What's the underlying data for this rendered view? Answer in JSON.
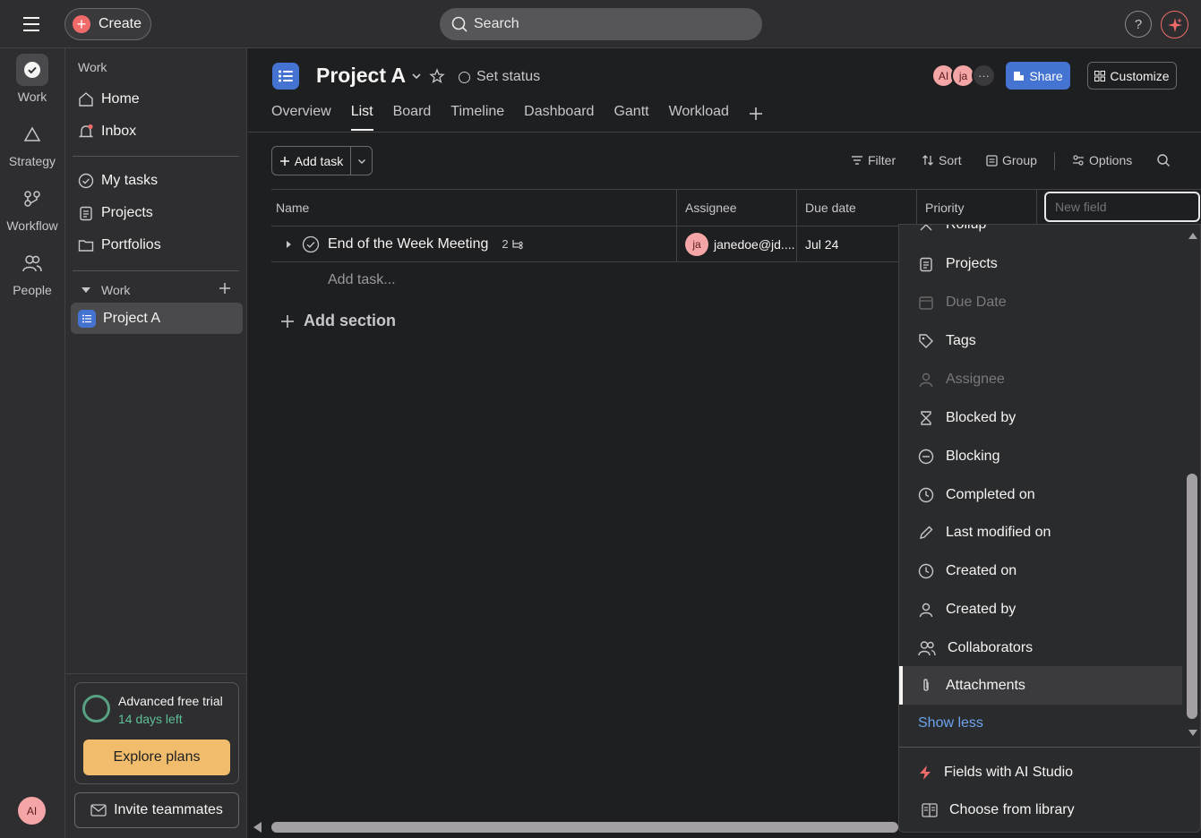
{
  "topbar": {
    "create_label": "Create",
    "search_placeholder": "Search",
    "help_label": "?"
  },
  "rail": {
    "items": [
      {
        "label": "Work",
        "icon": "check-circle-icon"
      },
      {
        "label": "Strategy",
        "icon": "triangle-icon"
      },
      {
        "label": "Workflow",
        "icon": "workflow-icon"
      },
      {
        "label": "People",
        "icon": "people-icon"
      }
    ],
    "avatar_initials": "AI"
  },
  "sidebar": {
    "section_label": "Work",
    "home_label": "Home",
    "inbox_label": "Inbox",
    "my_tasks_label": "My tasks",
    "projects_label": "Projects",
    "portfolios_label": "Portfolios",
    "work_group_label": "Work",
    "project_item_label": "Project A",
    "trial_title": "Advanced free trial",
    "trial_days": "14 days left",
    "explore_label": "Explore plans",
    "invite_label": "Invite teammates"
  },
  "project": {
    "title": "Project A",
    "set_status": "Set status",
    "avatars": [
      "AI",
      "ja"
    ],
    "share_label": "Share",
    "customize_label": "Customize",
    "tabs": [
      "Overview",
      "List",
      "Board",
      "Timeline",
      "Dashboard",
      "Gantt",
      "Workload"
    ],
    "active_tab": "List"
  },
  "toolbar": {
    "add_task_label": "Add task",
    "filter_label": "Filter",
    "sort_label": "Sort",
    "group_label": "Group",
    "options_label": "Options"
  },
  "table": {
    "columns": [
      "Name",
      "Assignee",
      "Due date",
      "Priority"
    ],
    "rows": [
      {
        "name": "End of the Week Meeting",
        "subtasks": "2",
        "assignee_initials": "ja",
        "assignee": "janedoe@jd....",
        "due": "Jul 24"
      }
    ],
    "add_task_placeholder": "Add task...",
    "add_section_label": "Add section"
  },
  "field_menu": {
    "input_placeholder": "New field",
    "items": [
      {
        "label": "Rollup",
        "icon": "rollup-icon",
        "disabled": false
      },
      {
        "label": "Projects",
        "icon": "projects-icon",
        "disabled": false
      },
      {
        "label": "Due Date",
        "icon": "calendar-icon",
        "disabled": true
      },
      {
        "label": "Tags",
        "icon": "tag-icon",
        "disabled": false
      },
      {
        "label": "Assignee",
        "icon": "person-icon",
        "disabled": true
      },
      {
        "label": "Blocked by",
        "icon": "hourglass-icon",
        "disabled": false
      },
      {
        "label": "Blocking",
        "icon": "minus-circle-icon",
        "disabled": false
      },
      {
        "label": "Completed on",
        "icon": "clock-icon",
        "disabled": false
      },
      {
        "label": "Last modified on",
        "icon": "pencil-icon",
        "disabled": false
      },
      {
        "label": "Created on",
        "icon": "clock-icon",
        "disabled": false
      },
      {
        "label": "Created by",
        "icon": "person-icon",
        "disabled": false
      },
      {
        "label": "Collaborators",
        "icon": "people-icon",
        "disabled": false
      },
      {
        "label": "Attachments",
        "icon": "paperclip-icon",
        "disabled": false
      }
    ],
    "selected": "Attachments",
    "show_less_label": "Show less",
    "ai_studio_label": "Fields with AI Studio",
    "library_label": "Choose from library"
  },
  "colors": {
    "accent_blue": "#4573d2",
    "coral": "#f06a6a",
    "explore_btn": "#f1bd6c",
    "link_blue": "#6ea4f0"
  }
}
